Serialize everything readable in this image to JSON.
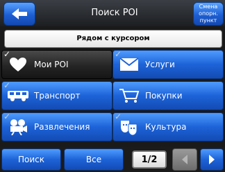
{
  "header": {
    "title": "Поиск POI",
    "mode_button_line1": "Смена",
    "mode_button_line2": "опорн. пункт"
  },
  "near_label": "Рядом с курсором",
  "categories": [
    {
      "label": "Мои POI",
      "icon": "heart-icon",
      "checked": true,
      "selected": true
    },
    {
      "label": "Услуги",
      "icon": "envelope-icon",
      "checked": true,
      "selected": false
    },
    {
      "label": "Транспорт",
      "icon": "bus-icon",
      "checked": true,
      "selected": false
    },
    {
      "label": "Покупки",
      "icon": "shopping-cart-icon",
      "checked": false,
      "selected": false
    },
    {
      "label": "Развлечения",
      "icon": "film-camera-icon",
      "checked": true,
      "selected": false
    },
    {
      "label": "Культура",
      "icon": "theater-masks-icon",
      "checked": true,
      "selected": false
    }
  ],
  "bottom": {
    "search_label": "Поиск",
    "all_label": "Все",
    "page_indicator": "1/2"
  },
  "colors": {
    "accent_blue": "#1d63d8",
    "selected_dark": "#252525"
  }
}
